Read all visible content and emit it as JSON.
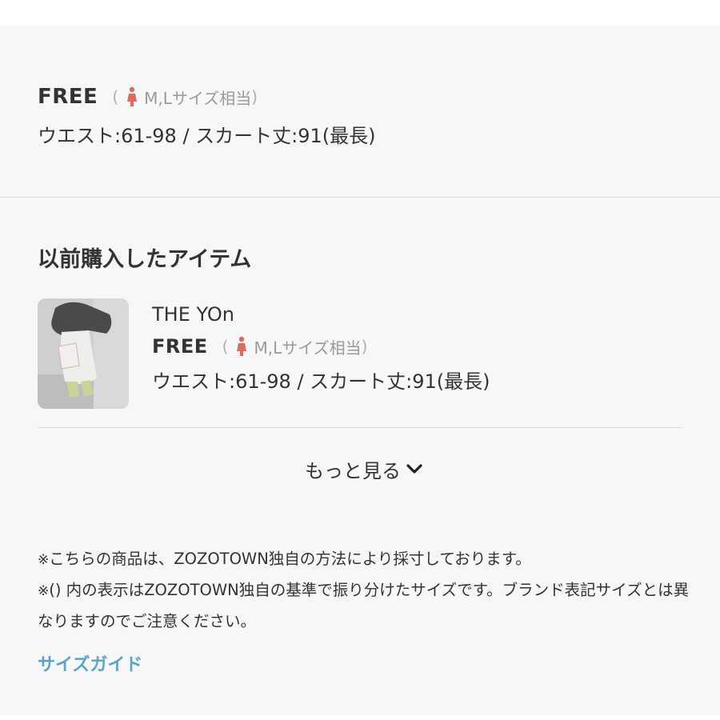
{
  "selected_size": {
    "name": "FREE",
    "equivalent": "M,Lサイズ相当",
    "measurements": "ウエスト:61-98 / スカート丈:91(最長)"
  },
  "previous_purchases": {
    "title": "以前購入したアイテム",
    "items": [
      {
        "brand": "THE YOn",
        "size_name": "FREE",
        "equivalent": "M,Lサイズ相当",
        "measurements": "ウエスト:61-98 / スカート丈:91(最長)"
      }
    ]
  },
  "more_button": {
    "label": "もっと見る"
  },
  "notes": {
    "mark": "※",
    "line1": "こちらの商品は、ZOZOTOWN独自の方法により採寸しております。",
    "line2": "() 内の表示はZOZOTOWN独自の基準で振り分けたサイズです。ブランド表記サイズとは異なりますのでご注意ください。"
  },
  "size_guide_link": {
    "label": "サイズガイド"
  },
  "colors": {
    "accent_link": "#5aa6c9",
    "person_icon": "#e06a5a",
    "background": "#f7f7f7"
  }
}
